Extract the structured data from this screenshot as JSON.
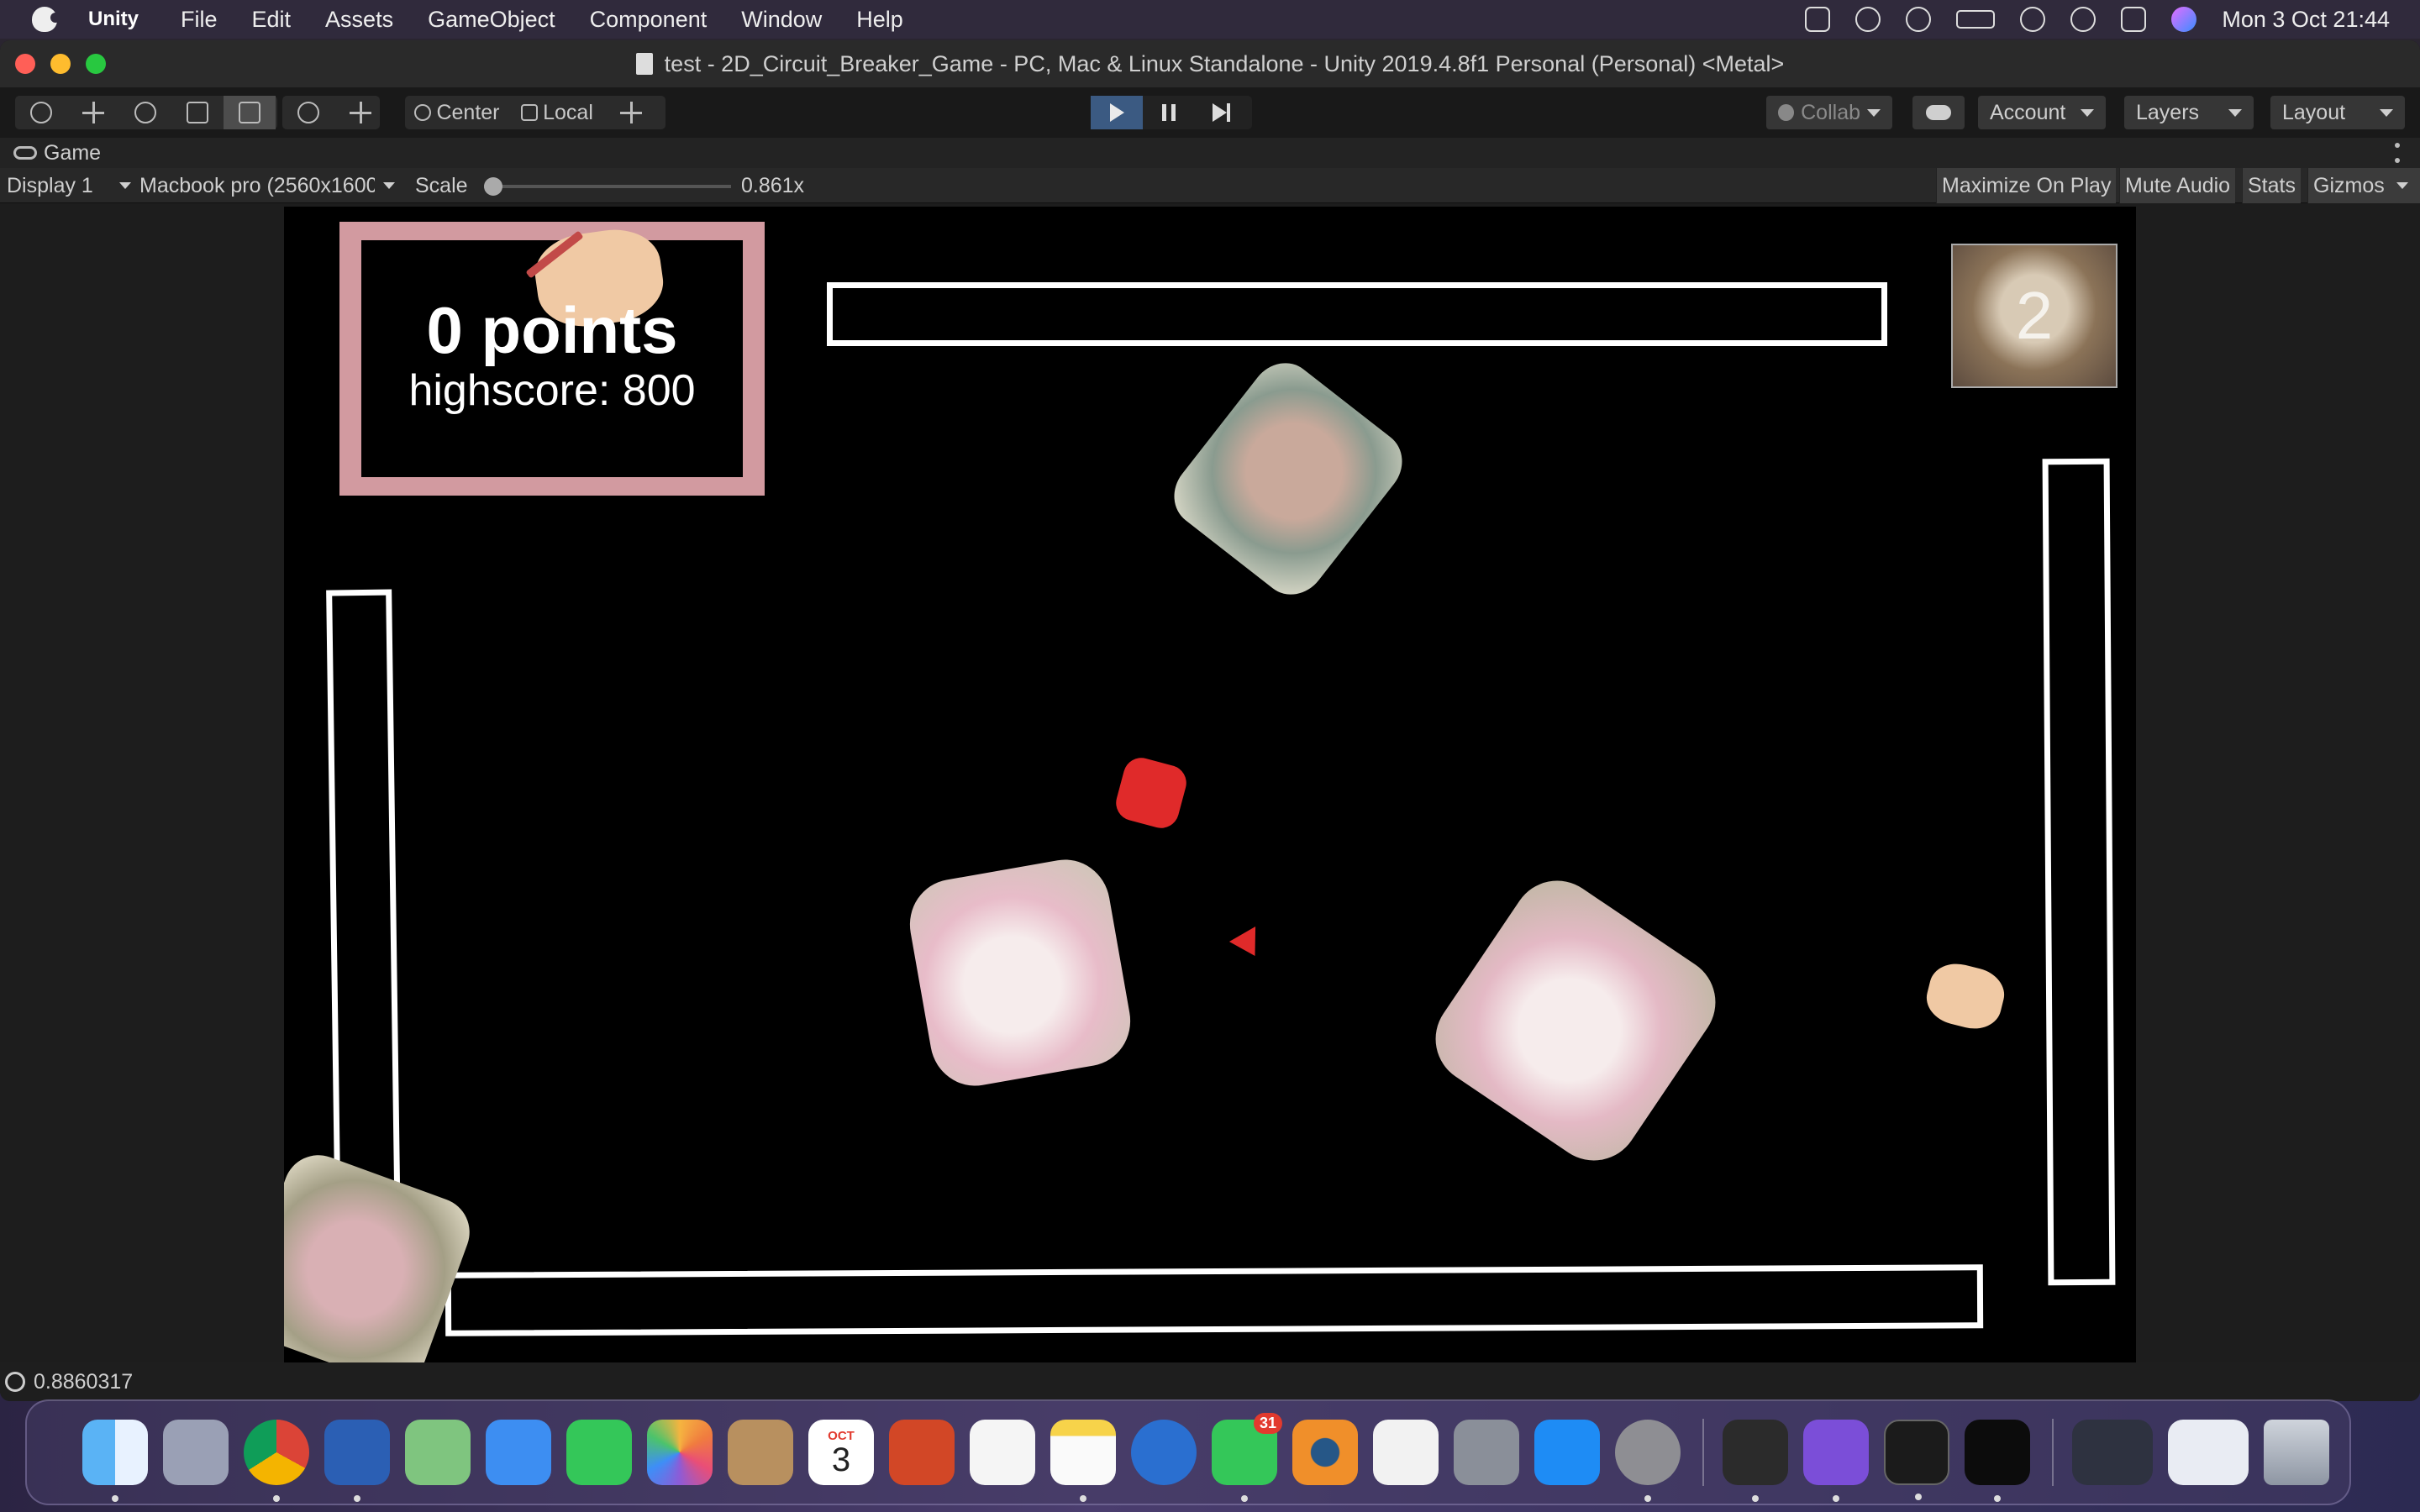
{
  "menubar": {
    "app_name": "Unity",
    "items": [
      "File",
      "Edit",
      "Assets",
      "GameObject",
      "Component",
      "Window",
      "Help"
    ],
    "datetime": "Mon 3 Oct  21:44"
  },
  "window": {
    "title": "test - 2D_Circuit_Breaker_Game - PC, Mac & Linux Standalone - Unity 2019.4.8f1 Personal (Personal) <Metal>"
  },
  "toolbar": {
    "pivot_label": "Center",
    "space_label": "Local",
    "collab_label": "Collab",
    "account_label": "Account",
    "layers_label": "Layers",
    "layout_label": "Layout"
  },
  "game_tab": {
    "label": "Game"
  },
  "game_bar": {
    "display": "Display 1",
    "resolution": "Macbook pro (2560x1600",
    "scale_label": "Scale",
    "scale_value": "0.861x",
    "scale_fraction": 0.0,
    "maximize": "Maximize On Play",
    "mute": "Mute Audio",
    "stats": "Stats",
    "gizmos": "Gizmos"
  },
  "game": {
    "points": "0 points",
    "highscore": "highscore: 800",
    "lives": "2"
  },
  "statusbar": {
    "message": "0.8860317"
  },
  "dock": {
    "apps": [
      "finder-icon",
      "launchpad-icon",
      "chrome-icon",
      "word-icon",
      "maps-icon",
      "mail-icon",
      "facetime-icon",
      "photos-icon",
      "contacts-icon",
      "calendar-icon",
      "powerpoint-icon",
      "reminders-icon",
      "notes-icon",
      "musescore-icon",
      "messages-icon",
      "blender-icon",
      "numbers-icon",
      "sketchbook-icon",
      "app-store-icon",
      "system-preferences-icon",
      "unity-hub-icon",
      "github-desktop-icon",
      "terminal-icon",
      "unity-icon"
    ],
    "calendar_month": "OCT",
    "calendar_day": "3",
    "messages_badge": "31"
  }
}
